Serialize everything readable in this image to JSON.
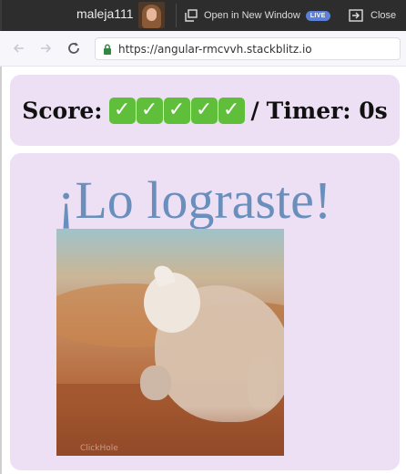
{
  "topbar": {
    "username": "maleja111",
    "open_new_window_label": "Open in New Window",
    "live_badge": "LIVE",
    "close_label": "Close"
  },
  "navbar": {
    "url": "https://angular-rmcvvh.stackblitz.io"
  },
  "score": {
    "label": "Score:",
    "checks": [
      "✓",
      "✓",
      "✓",
      "✓",
      "✓"
    ],
    "separator": "/",
    "timer_label": "Timer: 0s"
  },
  "result": {
    "title": "¡Lo lograste!",
    "gif_watermark": "ClickHole"
  },
  "colors": {
    "card_bg": "#ede0f4",
    "title_color": "#6a8fbd",
    "check_bg": "#5fbe3a",
    "live_badge": "#5c7fd9"
  }
}
